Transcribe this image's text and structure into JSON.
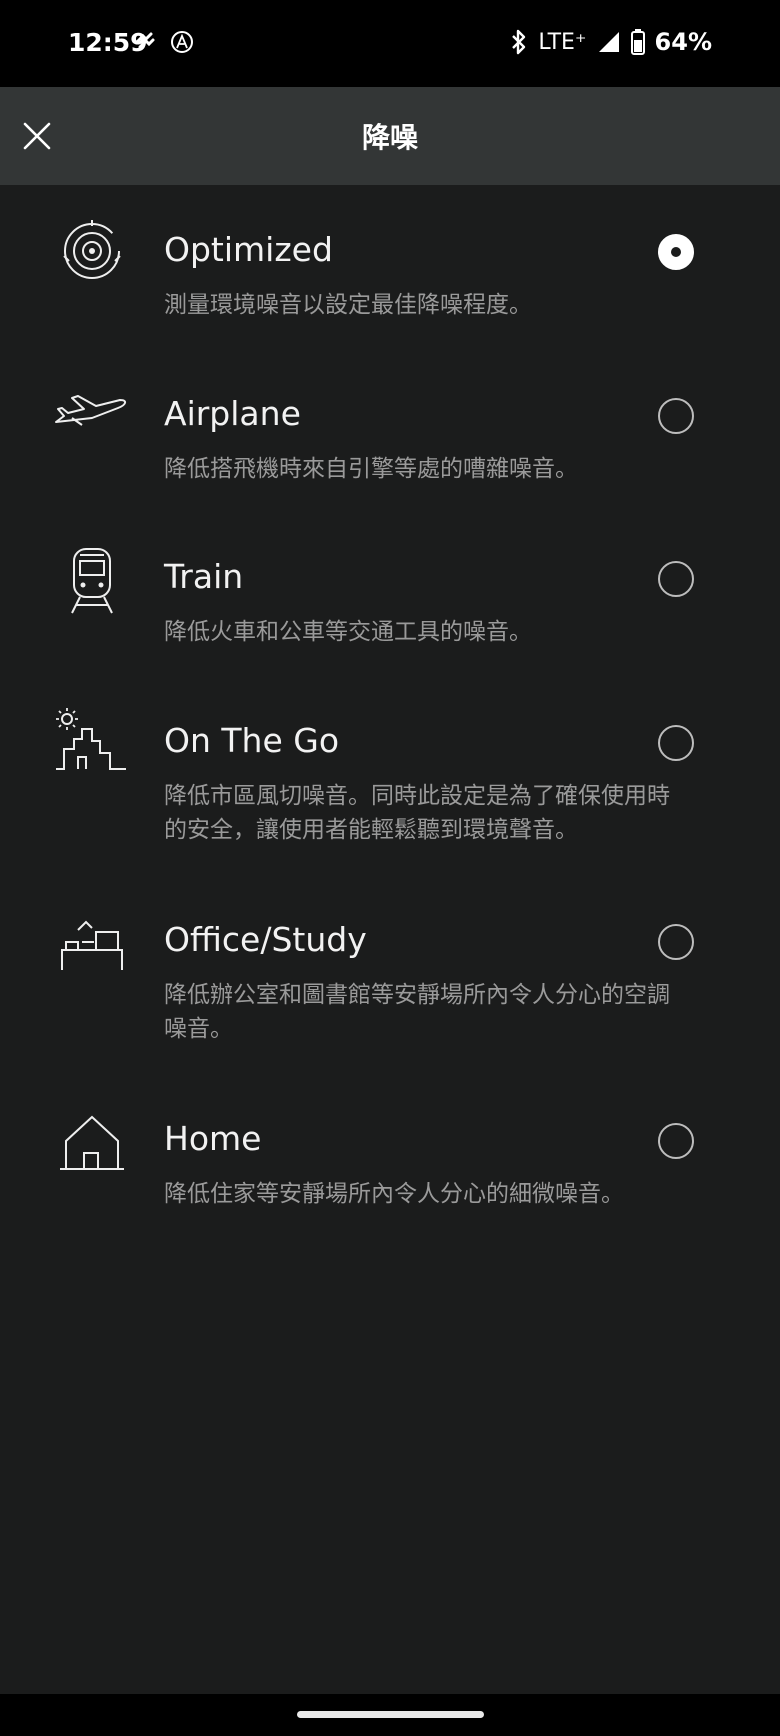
{
  "status_bar": {
    "time": "12:59",
    "network": "LTE⁺",
    "battery": "64%"
  },
  "header": {
    "title": "降噪"
  },
  "modes": [
    {
      "name": "Optimized",
      "description": "測量環境噪音以設定最佳降噪程度。",
      "icon": "target-rings-icon",
      "selected": true
    },
    {
      "name": "Airplane",
      "description": "降低搭飛機時來自引擎等處的嘈雜噪音。",
      "icon": "airplane-icon",
      "selected": false
    },
    {
      "name": "Train",
      "description": "降低火車和公車等交通工具的噪音。",
      "icon": "train-icon",
      "selected": false
    },
    {
      "name": "On The Go",
      "description": "降低市區風切噪音。同時此設定是為了確保使用時的安全，讓使用者能輕鬆聽到環境聲音。",
      "icon": "city-sun-icon",
      "selected": false
    },
    {
      "name": "Office/Study",
      "description": "降低辦公室和圖書館等安靜場所內令人分心的空調噪音。",
      "icon": "office-desk-icon",
      "selected": false
    },
    {
      "name": "Home",
      "description": "降低住家等安靜場所內令人分心的細微噪音。",
      "icon": "house-icon",
      "selected": false
    }
  ],
  "colors": {
    "background": "#1b1c1c",
    "header": "#333636",
    "text": "#f2f2f2",
    "subtext": "#9a9a9a"
  }
}
